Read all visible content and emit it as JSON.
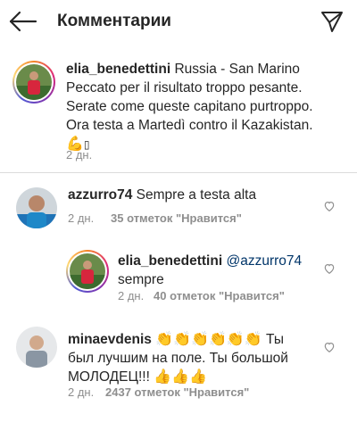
{
  "header": {
    "title": "Комментарии",
    "back_icon": "arrow-left-icon",
    "send_icon": "paper-plane-icon"
  },
  "caption": {
    "username": "elia_benedettini",
    "line1": " Russia - San Marino",
    "line2": "Peccato per il risultato troppo pesante.",
    "line3": "Serate come queste capitano purtroppo.",
    "line4": "Ora testa a Martedì contro il Kazakistan.",
    "emoji": "💪",
    "emoji_tail": "▯",
    "time": "2 дн."
  },
  "comments": [
    {
      "username": "azzurro74",
      "text": " Sempre a testa alta",
      "time": "2 дн.",
      "likes": "35 отметок \"Нравится\""
    },
    {
      "username": "elia_benedettini",
      "mention": "@azzurro74",
      "text": "sempre",
      "time": "2 дн.",
      "likes": "40 отметок \"Нравится\""
    },
    {
      "username": "minaevdenis",
      "emoji": "👏👏👏👏👏👏",
      "line1_tail": " Ты",
      "line2": "был лучшим на поле. Ты большой",
      "line3": "МОЛОДЕЦ!!! ",
      "line3_emoji": "👍👍👍",
      "time": "2 дн.",
      "likes": "2437 отметок \"Нравится\""
    }
  ],
  "colors": {
    "mention": "#003569",
    "meta": "#8e8e8e",
    "text": "#262626"
  }
}
